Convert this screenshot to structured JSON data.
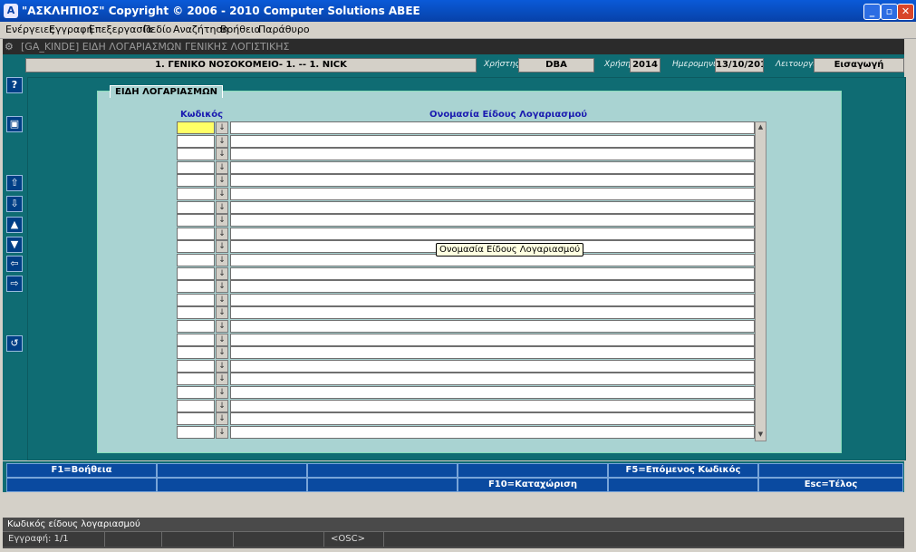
{
  "window": {
    "title": "\"ΑΣΚΛΗΠΙΟΣ\" Copyright © 2006 - 2010 Computer Solutions ABEE",
    "minimize": "_",
    "maximize": "▫",
    "close": "✕"
  },
  "menu": [
    "Ενέργειες",
    "Εγγραφή",
    "Επεξεργασία",
    "Πεδίο",
    "Αναζήτηση",
    "Βοήθεια",
    "Παράθυρο"
  ],
  "doc_window": {
    "title": "[GA_KINDE]  ΕΙΔΗ ΛΟΓΑΡΙΑΣΜΩΝ ΓΕΝΙΚΗΣ ΛΟΓΙΣΤΙΚΗΣ"
  },
  "info": {
    "organization": "1. ΓΕΝΙΚΟ ΝΟΣΟΚΟΜΕΙΟ- 1. -- 1. NICK",
    "user_label": "Χρήστης",
    "user": "DBA",
    "year_label": "Χρήση",
    "year": "2014",
    "date_label": "Ημερομηνία",
    "date": "13/10/2014",
    "mode_label": "Λειτουργία",
    "mode": "Εισαγωγή"
  },
  "sidebar_icons": [
    "help-icon",
    "save-icon",
    "first-record-icon",
    "last-record-icon",
    "previous-record-icon",
    "next-record-icon",
    "previous-block-icon",
    "next-block-icon",
    "exit-icon"
  ],
  "panel": {
    "tab": "ΕΙΔΗ ΛΟΓΑΡΙΑΣΜΩΝ",
    "col_code": "Κωδικός",
    "col_name": "Ονομασία Είδους Λογαριασμού",
    "row_count": 24,
    "tooltip": "Ονομασία Είδους Λογαριασμού"
  },
  "fkeys": {
    "row1": [
      "F1=Βοήθεια",
      "",
      "",
      "",
      "F5=Επόμενος Κωδικός",
      ""
    ],
    "row2": [
      "",
      "",
      "",
      "F10=Καταχώριση",
      "",
      "Esc=Τέλος"
    ]
  },
  "status": {
    "message": "Κωδικός είδους λογαριασμού",
    "record": "Εγγραφή: 1/1",
    "osc": "<OSC>"
  },
  "colors": {
    "teal": "#0f6c73",
    "panel": "#a9d3d2",
    "fkey": "#0a4aa0",
    "active_field": "#ffff66"
  }
}
